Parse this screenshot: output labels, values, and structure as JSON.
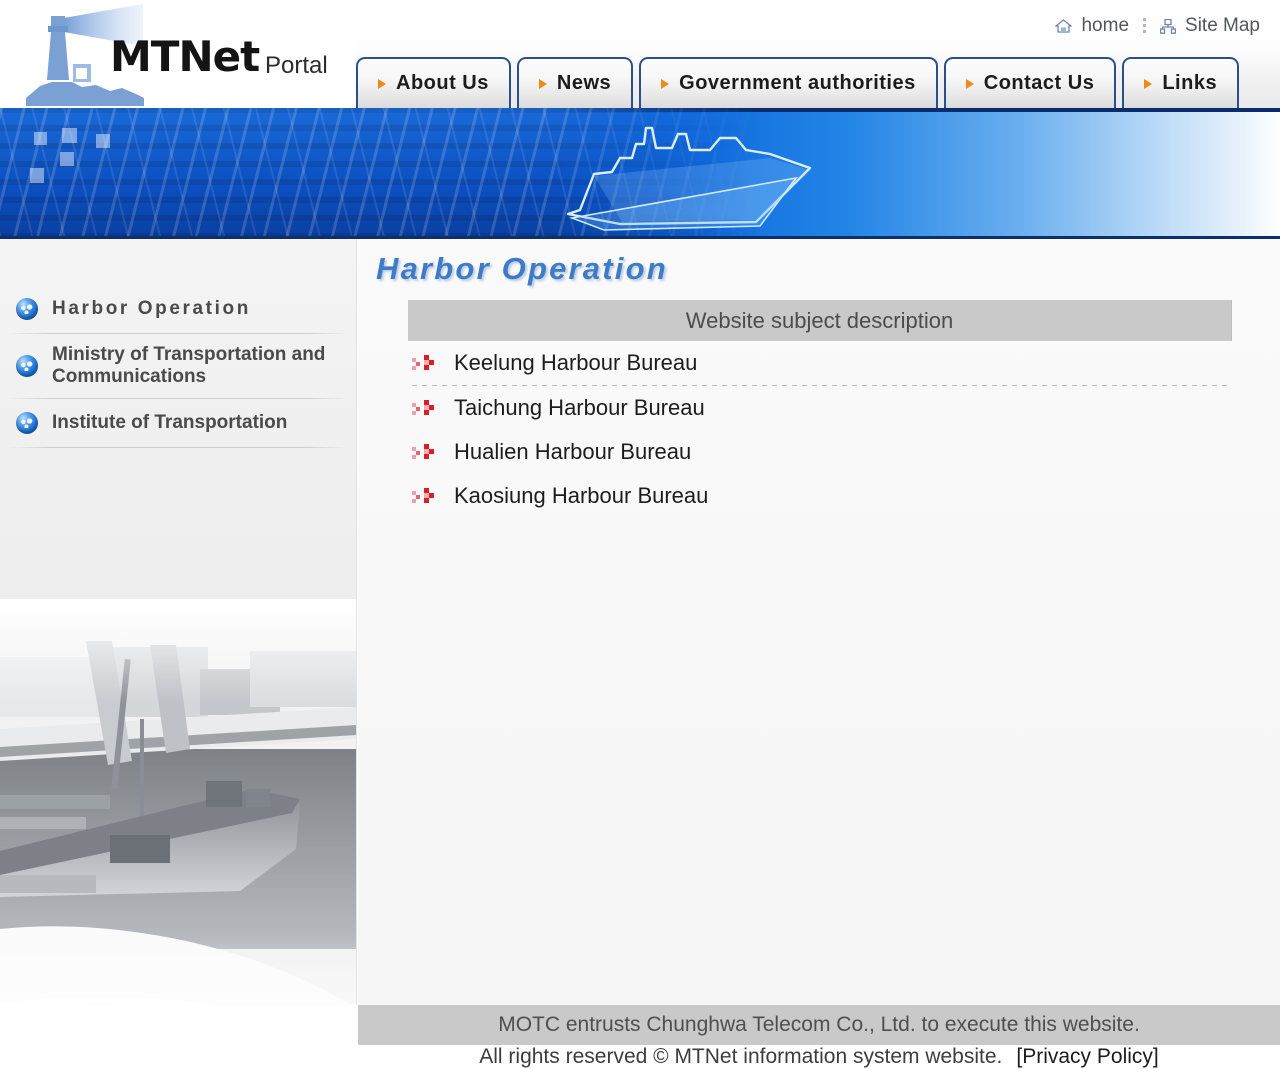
{
  "brand": {
    "name": "MTNet",
    "subtitle": "Portal",
    "logo_icon": "lighthouse-icon"
  },
  "utility": {
    "home": {
      "label": "home",
      "icon": "home-icon"
    },
    "sitemap": {
      "label": "Site Map",
      "icon": "sitemap-icon"
    }
  },
  "nav": {
    "tabs": [
      {
        "label": "About Us",
        "icon": "triangle-right-icon"
      },
      {
        "label": "News",
        "icon": "triangle-right-icon"
      },
      {
        "label": "Government authorities",
        "icon": "triangle-right-icon"
      },
      {
        "label": "Contact Us",
        "icon": "triangle-right-icon"
      },
      {
        "label": "Links",
        "icon": "triangle-right-icon"
      }
    ]
  },
  "banner": {
    "alt": "blue harbor crane and ship banner",
    "accent": "#0d5bcf"
  },
  "sidebar": {
    "items": [
      {
        "label": "Harbor Operation",
        "icon": "globe-icon",
        "spaced": true
      },
      {
        "label": "Ministry of Transportation and Communications",
        "icon": "globe-icon",
        "spaced": false
      },
      {
        "label": "Institute of Transportation",
        "icon": "globe-icon",
        "spaced": false
      }
    ],
    "photo_alt": "grayscale harbor loading dock photo"
  },
  "main": {
    "page_title": "Harbor Operation",
    "column_header": "Website subject description",
    "rows": [
      {
        "label": "Keelung Harbour Bureau",
        "icon": "red-double-arrow-icon"
      },
      {
        "label": "Taichung Harbour Bureau",
        "icon": "red-double-arrow-icon"
      },
      {
        "label": "Hualien Harbour Bureau",
        "icon": "red-double-arrow-icon"
      },
      {
        "label": "Kaosiung Harbour Bureau",
        "icon": "red-double-arrow-icon"
      }
    ]
  },
  "footer": {
    "line1": "MOTC entrusts Chunghwa Telecom Co., Ltd. to execute this website.",
    "line2": "All rights reserved © MTNet information system website.",
    "privacy": "[Privacy Policy]"
  },
  "colors": {
    "title_blue": "#3e7bc8",
    "tab_border": "#2b4f86",
    "tab_bullet_orange": "#f08a16",
    "bar_gray": "#c9c9c9",
    "bullet_red": "#d81f27"
  }
}
